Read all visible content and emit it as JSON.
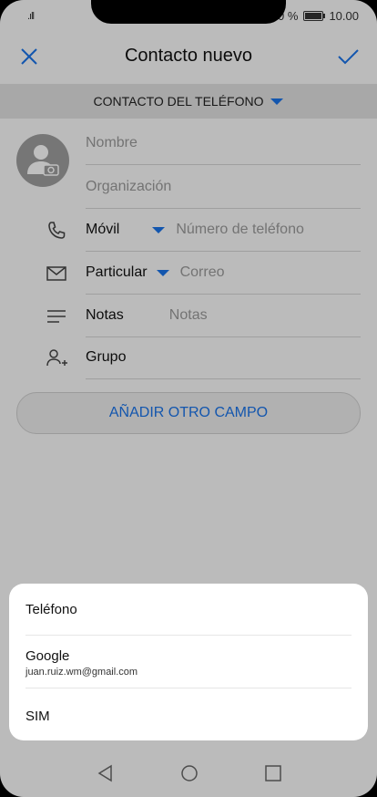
{
  "status": {
    "signal": ".ıll",
    "battery": "100 %",
    "time": "10.00"
  },
  "header": {
    "title": "Contacto nuevo"
  },
  "account_selector": {
    "label": "CONTACTO DEL TELÉFONO"
  },
  "form": {
    "name_placeholder": "Nombre",
    "org_placeholder": "Organización",
    "phone_type": "Móvil",
    "phone_placeholder": "Número de teléfono",
    "email_type": "Particular",
    "email_placeholder": "Correo",
    "notes_label": "Notas",
    "notes_placeholder": "Notas",
    "group_label": "Grupo"
  },
  "add_field": {
    "label": "AÑADIR OTRO CAMPO"
  },
  "sheet": {
    "options": [
      {
        "name": "Teléfono"
      },
      {
        "name": "Google",
        "sub": "juan.ruiz.wm@gmail.com"
      },
      {
        "name": "SIM"
      }
    ]
  },
  "colors": {
    "accent": "#1a73e8",
    "overlay": "rgba(0,0,0,0.25)"
  }
}
